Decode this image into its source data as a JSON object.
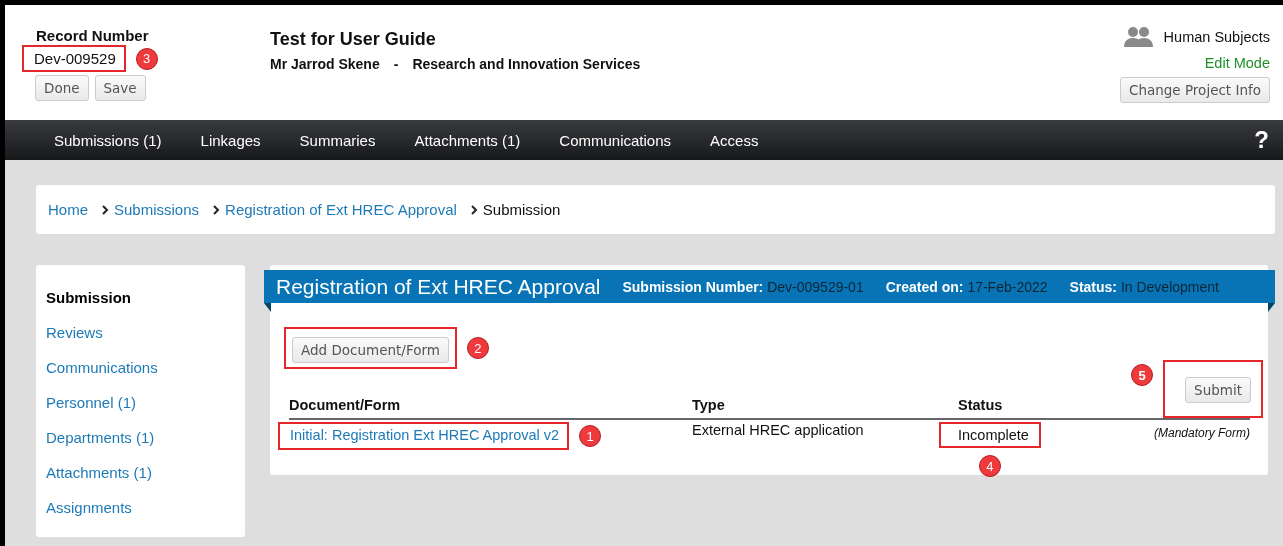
{
  "header": {
    "record_label": "Record Number",
    "record_number": "Dev-009529",
    "record_callout": "3",
    "buttons": [
      "Done",
      "Save"
    ],
    "project_title": "Test for User Guide",
    "person": "Mr Jarrod Skene",
    "separator": "-",
    "department": "Research and Innovation Services",
    "project_type": "Human Subjects",
    "mode": "Edit Mode",
    "change_button": "Change Project Info"
  },
  "nav": {
    "items": [
      "Submissions (1)",
      "Linkages",
      "Summaries",
      "Attachments (1)",
      "Communications",
      "Access"
    ],
    "help": "?"
  },
  "breadcrumb": [
    {
      "label": "Home",
      "kind": "link"
    },
    {
      "label": "Submissions",
      "kind": "link"
    },
    {
      "label": "Registration of Ext HREC Approval",
      "kind": "link"
    },
    {
      "label": "Submission",
      "kind": "current"
    }
  ],
  "sidebar": {
    "items": [
      {
        "label": "Submission",
        "selected": true
      },
      {
        "label": "Reviews",
        "selected": false
      },
      {
        "label": "Communications",
        "selected": false
      },
      {
        "label": "Personnel (1)",
        "selected": false
      },
      {
        "label": "Departments (1)",
        "selected": false
      },
      {
        "label": "Attachments (1)",
        "selected": false
      },
      {
        "label": "Assignments",
        "selected": false
      }
    ]
  },
  "submission": {
    "title": "Registration of Ext HREC Approval",
    "meta": [
      {
        "label": "Submission Number:",
        "value": "Dev-009529-01"
      },
      {
        "label": "Created on:",
        "value": "17-Feb-2022"
      },
      {
        "label": "Status:",
        "value": "In Development"
      }
    ],
    "add_button": {
      "label": "Add Document/Form",
      "callout": "2"
    },
    "submit_button": {
      "label": "Submit",
      "callout": "5"
    },
    "table": {
      "columns": [
        "Document/Form",
        "Type",
        "Status"
      ],
      "rows": [
        {
          "document": "Initial: Registration Ext HREC Approval v2",
          "document_callout": "1",
          "type": "External HREC application",
          "status": "Incomplete",
          "status_callout": "4",
          "note": "(Mandatory Form)"
        }
      ]
    }
  }
}
